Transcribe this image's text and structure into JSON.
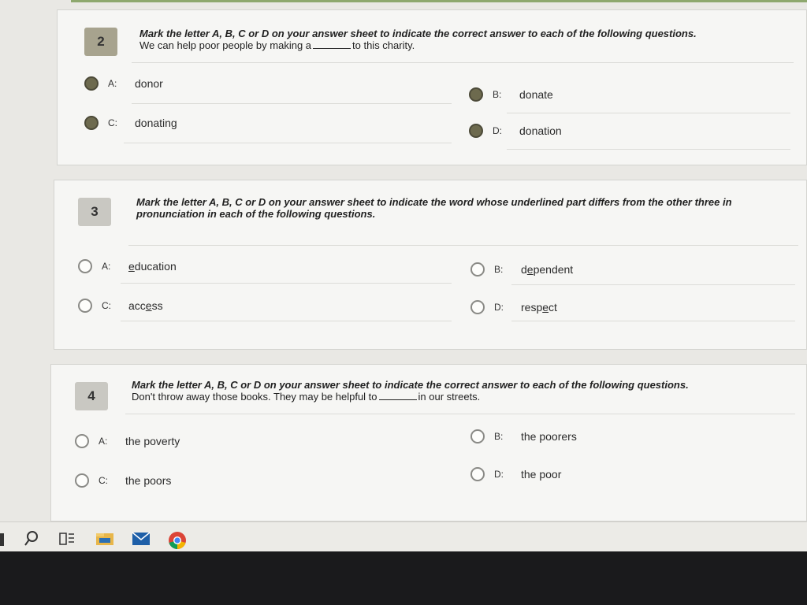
{
  "questions": [
    {
      "number": "2",
      "instruction": "Mark the letter A, B, C or D on your answer sheet to indicate the correct answer to each of the following questions.",
      "stem_before": "We can help poor people by making a",
      "stem_after": "to this charity.",
      "options": [
        {
          "letter": "A:",
          "text": "donor"
        },
        {
          "letter": "B:",
          "text": "donate"
        },
        {
          "letter": "C:",
          "text": "donating"
        },
        {
          "letter": "D:",
          "text": "donation"
        }
      ]
    },
    {
      "number": "3",
      "instruction": "Mark the letter A, B, C or D on your answer sheet to indicate the word whose underlined part differs from the other three in pronunciation in each of the following questions.",
      "options": [
        {
          "letter": "A:",
          "pre": "",
          "under": "e",
          "post": "ducation"
        },
        {
          "letter": "B:",
          "pre": "d",
          "under": "e",
          "post": "pendent"
        },
        {
          "letter": "C:",
          "pre": "acc",
          "under": "e",
          "post": "ss"
        },
        {
          "letter": "D:",
          "pre": "resp",
          "under": "e",
          "post": "ct"
        }
      ]
    },
    {
      "number": "4",
      "instruction": "Mark the letter A, B, C or D on your answer sheet to indicate the correct answer to each of the following questions.",
      "stem_before": "Don't throw away those books. They may be helpful to",
      "stem_after": "in our streets.",
      "options": [
        {
          "letter": "A:",
          "text": "the poverty"
        },
        {
          "letter": "B:",
          "text": "the poorers"
        },
        {
          "letter": "C:",
          "text": "the poors"
        },
        {
          "letter": "D:",
          "text": "the poor"
        }
      ]
    }
  ],
  "taskbar": {
    "icons": [
      "search-icon",
      "task-view-icon",
      "file-explorer-icon",
      "mail-icon",
      "chrome-icon"
    ]
  },
  "colors": {
    "card_bg": "#f6f6f4",
    "selected_radio": "#6d6a4e",
    "accent_line": "#8ea86e"
  }
}
